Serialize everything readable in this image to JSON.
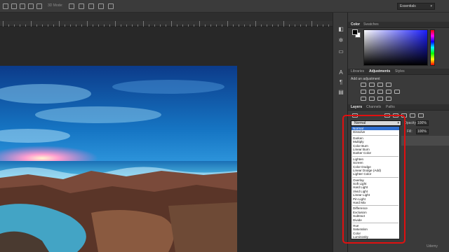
{
  "options_bar": {
    "mode_3d_label": "3D Mode:",
    "workspace": "Essentials"
  },
  "panels": {
    "color_tabs": [
      "Color",
      "Swatches"
    ],
    "adjust_tabs": [
      "Libraries",
      "Adjustments",
      "Styles"
    ],
    "adjust_hint": "Add an adjustment",
    "layers_tabs": [
      "Layers",
      "Channels",
      "Paths"
    ],
    "active_adjust_tab": "Adjustments",
    "active_layers_tab": "Layers"
  },
  "layers": {
    "blend_mode": "Normal",
    "opacity_label": "Opacity:",
    "opacity_value": "100%",
    "fill_label": "Fill:",
    "fill_value": "100%"
  },
  "blend_modes": {
    "groups": [
      [
        "Normal",
        "Dissolve"
      ],
      [
        "Darken",
        "Multiply",
        "Color Burn",
        "Linear Burn",
        "Darker Color"
      ],
      [
        "Lighten",
        "Screen",
        "Color Dodge",
        "Linear Dodge (Add)",
        "Lighter Color"
      ],
      [
        "Overlay",
        "Soft Light",
        "Hard Light",
        "Vivid Light",
        "Linear Light",
        "Pin Light",
        "Hard Mix"
      ],
      [
        "Difference",
        "Exclusion",
        "Subtract",
        "Divide"
      ],
      [
        "Hue",
        "Saturation",
        "Color",
        "Luminosity"
      ]
    ],
    "selected": "Normal"
  },
  "colors": {
    "highlight": "#e01010",
    "selection": "#2f6fd1"
  },
  "watermark": "Udemy"
}
